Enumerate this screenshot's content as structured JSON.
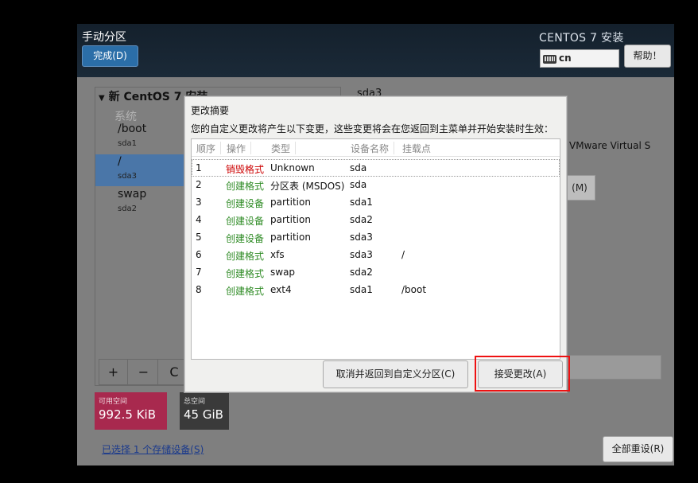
{
  "header": {
    "page_title": "手动分区",
    "done_label": "完成(D)",
    "install_title": "CENTOS 7 安装",
    "keyboard_layout": "cn",
    "help_label": "帮助！"
  },
  "left_panel": {
    "tree_header": "新 CentOS 7 安装",
    "system_label": "系统",
    "items": [
      {
        "mount": "/boot",
        "device": "sda1"
      },
      {
        "mount": "/",
        "device": "sda3"
      },
      {
        "mount": "swap",
        "device": "sda2"
      }
    ],
    "add_label": "+",
    "remove_label": "−",
    "refresh_label": "C"
  },
  "space": {
    "available_label": "可用空间",
    "available_value": "992.5 KiB",
    "total_label": "总空间",
    "total_value": "45 GiB"
  },
  "storage_link": "已选择 1 个存储设备(S)",
  "reset_label": "全部重设(R)",
  "right_panel": {
    "device_heading": "sda3",
    "device_desc": "VMware Virtual S",
    "modify_label": "(M)"
  },
  "dialog": {
    "title": "更改摘要",
    "description": "您的自定义更改将产生以下变更，这些变更将会在您返回到主菜单并开始安装时生效：",
    "columns": [
      "顺序",
      "操作",
      "类型",
      "设备名称",
      "挂载点"
    ],
    "rows": [
      {
        "order": "1",
        "action": "销毁格式",
        "type": "Unknown",
        "device": "sda",
        "mount": ""
      },
      {
        "order": "2",
        "action": "创建格式",
        "type": "分区表 (MSDOS)",
        "device": "sda",
        "mount": ""
      },
      {
        "order": "3",
        "action": "创建设备",
        "type": "partition",
        "device": "sda1",
        "mount": ""
      },
      {
        "order": "4",
        "action": "创建设备",
        "type": "partition",
        "device": "sda2",
        "mount": ""
      },
      {
        "order": "5",
        "action": "创建设备",
        "type": "partition",
        "device": "sda3",
        "mount": ""
      },
      {
        "order": "6",
        "action": "创建格式",
        "type": "xfs",
        "device": "sda3",
        "mount": "/"
      },
      {
        "order": "7",
        "action": "创建格式",
        "type": "swap",
        "device": "sda2",
        "mount": ""
      },
      {
        "order": "8",
        "action": "创建格式",
        "type": "ext4",
        "device": "sda1",
        "mount": "/boot"
      }
    ],
    "cancel_label": "取消并返回到自定义分区(C)",
    "accept_label": "接受更改(A)"
  },
  "colors": {
    "destroy_action": "#cc0000",
    "create_action": "#2e8b24",
    "highlight": "#ee1111",
    "available_box": "#a8294e",
    "selected_row": "#4a76a8"
  }
}
